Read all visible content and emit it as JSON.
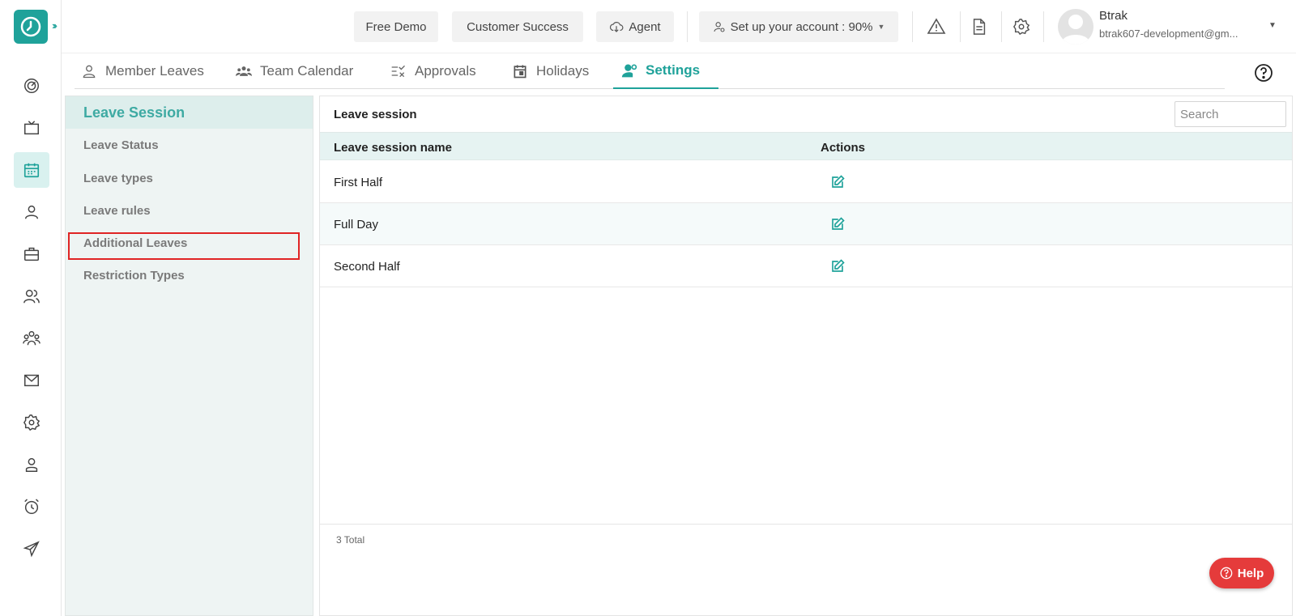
{
  "topbar": {
    "free_demo": "Free Demo",
    "customer_success": "Customer Success",
    "agent": "Agent",
    "setup": "Set up your account : 90%",
    "user_name": "Btrak",
    "user_email": "btrak607-development@gm..."
  },
  "tabs": [
    {
      "label": "Member Leaves",
      "icon": "person-icon"
    },
    {
      "label": "Team Calendar",
      "icon": "team-icon"
    },
    {
      "label": "Approvals",
      "icon": "approvals-icon"
    },
    {
      "label": "Holidays",
      "icon": "calendar-icon"
    },
    {
      "label": "Settings",
      "icon": "user-settings-icon",
      "active": true
    }
  ],
  "side_menu": {
    "header": "Leave Session",
    "items": [
      "Leave Status",
      "Leave types",
      "Leave rules",
      "Additional Leaves",
      "Restriction Types"
    ],
    "highlighted": "Additional Leaves"
  },
  "main": {
    "title": "Leave session",
    "search_placeholder": "Search",
    "columns": [
      "Leave session name",
      "Actions"
    ],
    "rows": [
      "First Half",
      "Full Day",
      "Second Half"
    ],
    "total": "3 Total"
  },
  "help_button": "Help",
  "colors": {
    "accent": "#1fa29a",
    "highlight": "#e02424",
    "help": "#e53b3b"
  }
}
